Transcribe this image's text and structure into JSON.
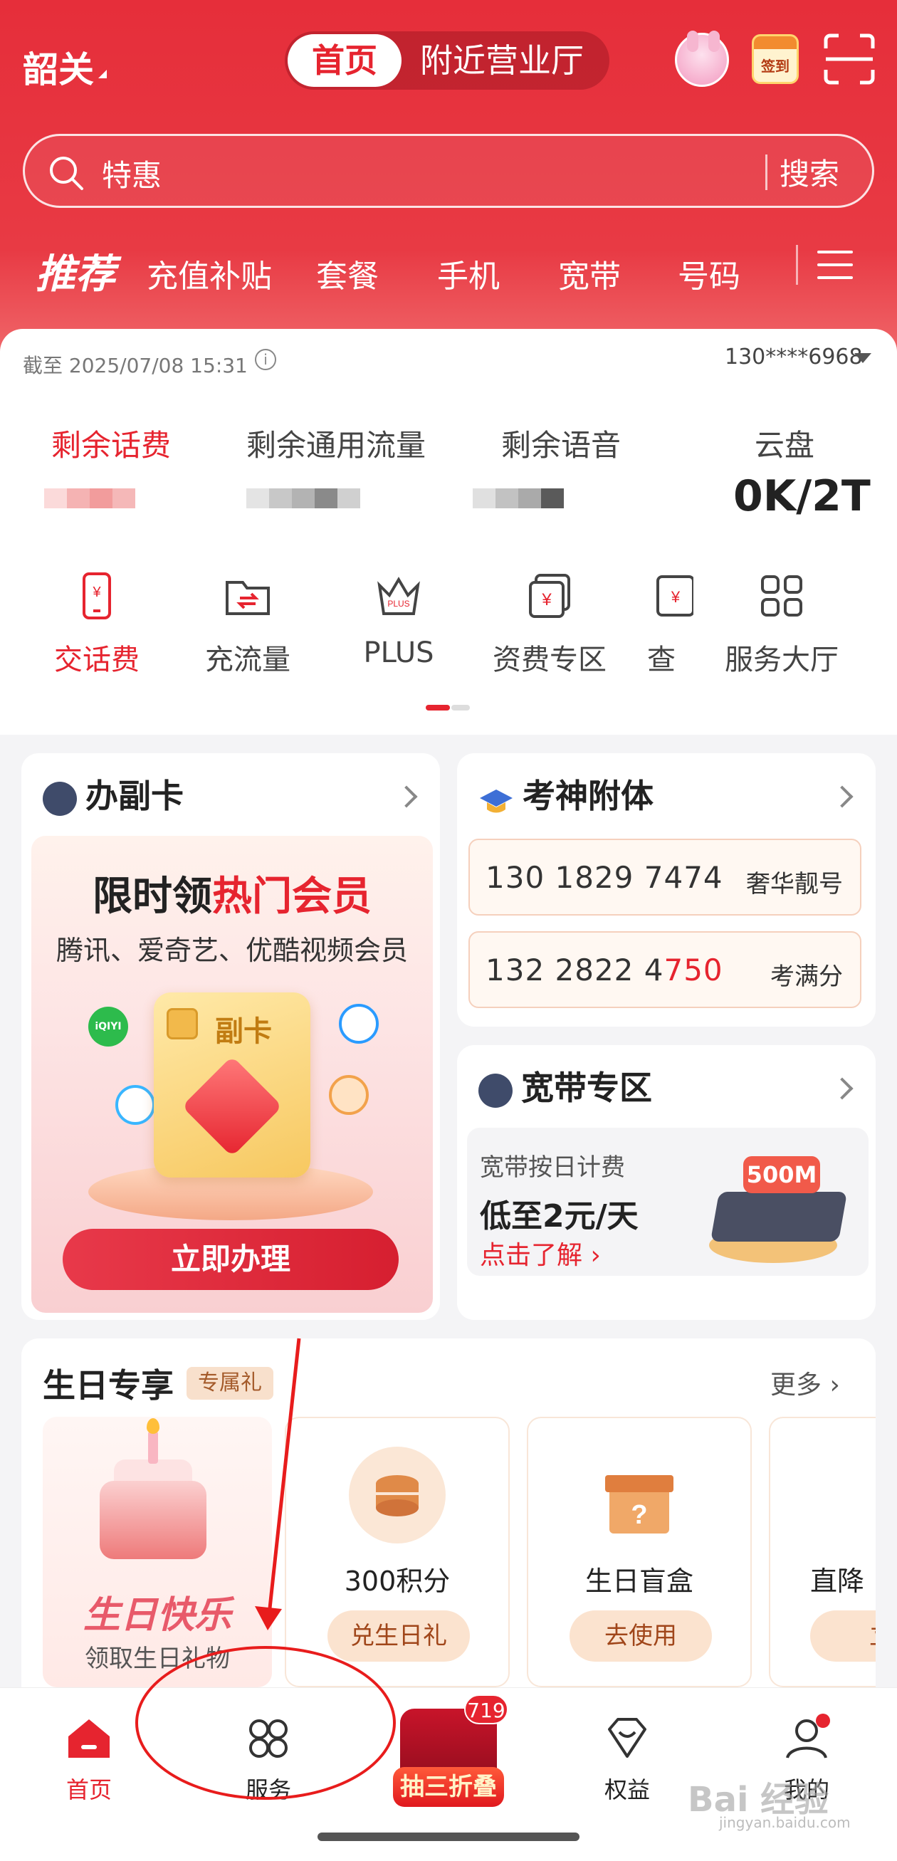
{
  "header": {
    "city": "韶关",
    "tabs": [
      {
        "label": "首页",
        "active": true
      },
      {
        "label": "附近营业厅",
        "active": false
      }
    ],
    "signin_label": "签到",
    "search_placeholder": "特惠",
    "search_button": "搜索",
    "categories_lead": "推荐",
    "categories": [
      "充值补贴",
      "套餐",
      "手机",
      "宽带",
      "号码"
    ]
  },
  "account": {
    "as_of": "截至 2025/07/08 15:31",
    "phone": "130****6968",
    "balances": [
      {
        "label": "剩余话费"
      },
      {
        "label": "剩余通用流量"
      },
      {
        "label": "剩余语音"
      },
      {
        "label": "云盘",
        "value": "0K/2T"
      }
    ],
    "quick": [
      {
        "label": "交话费",
        "icon": "phone-bill-icon"
      },
      {
        "label": "充流量",
        "icon": "data-transfer-icon"
      },
      {
        "label": "PLUS",
        "icon": "plus-crown-icon"
      },
      {
        "label": "资费专区",
        "icon": "tariff-icon"
      },
      {
        "label": "查",
        "icon": "query-icon"
      },
      {
        "label": "服务大厅",
        "icon": "grid-icon"
      }
    ]
  },
  "fuka": {
    "title": "办副卡",
    "headline_a": "限时领",
    "headline_b": "热门会员",
    "sub": "腾讯、爱奇艺、优酷视频会员",
    "card_label": "副卡",
    "iqiyi": "iQIYI",
    "cta": "立即办理"
  },
  "kaoshen": {
    "title": "考神附体",
    "numbers": [
      {
        "a": "130 1829 7474",
        "b": "",
        "tag": "奢华靓号"
      },
      {
        "a": "132 2822 4",
        "b": "750",
        "tag": "考满分"
      }
    ]
  },
  "broadband": {
    "title": "宽带专区",
    "line1": "宽带按日计费",
    "line2": "低至2元/天",
    "line3": "点击了解",
    "speed": "500M"
  },
  "birthday": {
    "title": "生日专享",
    "tag": "专属礼",
    "more": "更多",
    "cake_title": "生日快乐",
    "cake_sub": "领取生日礼物",
    "gifts": [
      {
        "label": "300积分",
        "button": "兑生日礼"
      },
      {
        "label": "生日盲盒",
        "button": "去使用"
      },
      {
        "label": "直降",
        "button": "立"
      }
    ]
  },
  "tabbar": {
    "home": "首页",
    "service": "服务",
    "promo": "抽三折叠",
    "promo_badge": "719",
    "rights": "权益",
    "mine": "我的"
  },
  "watermark": {
    "main": "Bai 经验",
    "url": "jingyan.baidu.com"
  },
  "colors": {
    "brand_red": "#e6242f",
    "annotation": "#e81c1c"
  }
}
